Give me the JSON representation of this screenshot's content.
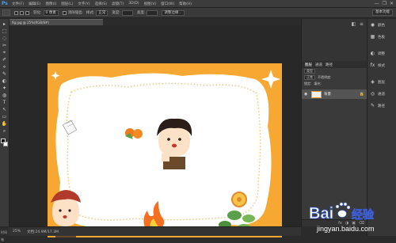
{
  "app": {
    "logo": "Ps"
  },
  "menu": [
    "文件(F)",
    "编辑(E)",
    "图像(I)",
    "图层(L)",
    "文字(Y)",
    "选择(S)",
    "滤镜(T)",
    "3D(D)",
    "视图(V)",
    "窗口(W)",
    "帮助(H)"
  ],
  "window_controls": [
    "—",
    "❐",
    "✕"
  ],
  "options": {
    "mode_label": "新选区",
    "feather_label": "羽化:",
    "feather_value": "0 像素",
    "antialias_label": "消除锯齿",
    "style_label": "样式:",
    "style_value": "正常",
    "width_label": "宽度:",
    "height_label": "高度:",
    "refine_label": "调整边缘...",
    "workspace": "基本功能"
  },
  "tools": [
    "▸",
    "⬚",
    "◌",
    "✂",
    "⌖",
    "✐",
    "⟡",
    "✎",
    "◐",
    "✦",
    "◍",
    "T",
    "↖",
    "▭",
    "✋",
    "⌕"
  ],
  "document": {
    "tab": "fig.jpg @ 25%(RGB/8#)"
  },
  "status": {
    "zoom": "25%",
    "doc_size": "文档:24.9M/17.3M"
  },
  "timeline_label": "时间轴",
  "dock_top_icons": [
    "◧",
    "≡"
  ],
  "layers_panel": {
    "tabs": [
      "图层",
      "通道",
      "路径"
    ],
    "kind_label": "类型",
    "blend_mode": "正常",
    "opacity_label": "不透明度:",
    "lock_label": "锁定:",
    "fill_label": "填充:",
    "layer_name": "背景",
    "footer_icons": [
      "fx",
      "◑",
      "▣",
      "⌫"
    ]
  },
  "right_dock": [
    {
      "icon": "color-icon",
      "glyph": "◉",
      "label": "颜色"
    },
    {
      "icon": "swatches-icon",
      "glyph": "▦",
      "label": "色板"
    },
    {
      "icon": "adjust-icon",
      "glyph": "◐",
      "label": "调整"
    },
    {
      "icon": "styles-icon",
      "glyph": "fx",
      "label": "样式"
    },
    {
      "icon": "layers-icon",
      "glyph": "◈",
      "label": "图层"
    },
    {
      "icon": "channels-icon",
      "glyph": "◎",
      "label": "通道"
    },
    {
      "icon": "paths-icon",
      "glyph": "✎",
      "label": "路径"
    }
  ],
  "watermark": {
    "brand": "Bai",
    "brand_suffix": "经验",
    "url": "jingyan.baidu.com"
  },
  "colors": {
    "canvas_orange": "#f6a833",
    "frame_white": "#ffffff",
    "dots": "#f1c46e"
  }
}
